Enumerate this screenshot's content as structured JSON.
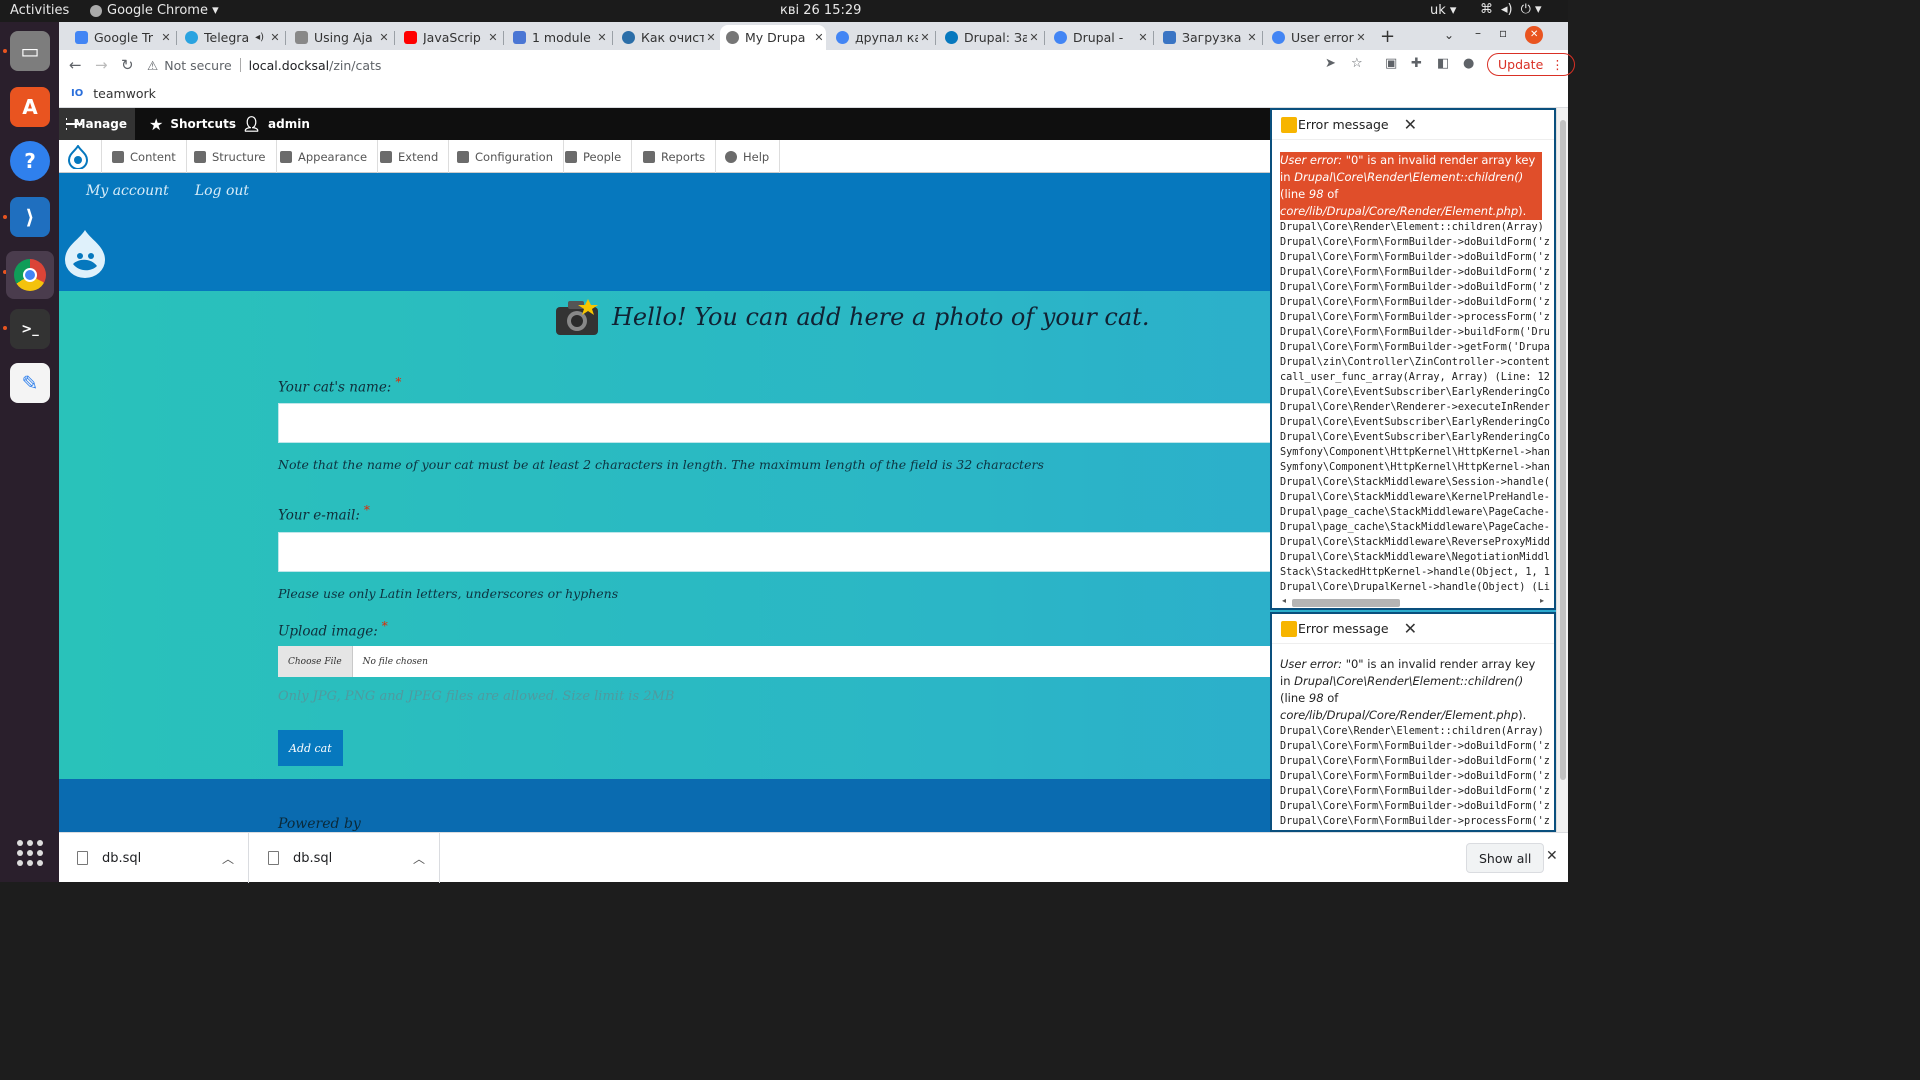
{
  "topbar": {
    "activities": "Activities",
    "app_name": "Google Chrome ▾",
    "clock": "кві 26  15:29",
    "lang": "uk ▾",
    "sys_icons": [
      "network-icon",
      "volume-icon",
      "power-icon"
    ]
  },
  "dock": {
    "items": [
      {
        "name": "files-icon",
        "color": "#7f7f7f",
        "glyph": "▭"
      },
      {
        "name": "software-center-icon",
        "color": "#e95420",
        "glyph": "A"
      },
      {
        "name": "help-icon",
        "color": "#2f80ed",
        "glyph": "?"
      },
      {
        "name": "vscode-icon",
        "color": "#1f6fbf",
        "glyph": "⟩"
      },
      {
        "name": "chrome-icon",
        "color": "#3a3a3a",
        "glyph": "◉"
      },
      {
        "name": "terminal-icon",
        "color": "#333",
        "glyph": ">_"
      },
      {
        "name": "text-editor-icon",
        "color": "#f4f4f4",
        "glyph": "✎"
      }
    ]
  },
  "tabs": [
    {
      "title": "Google Tr",
      "icon_color": "#4285f4"
    },
    {
      "title": "Telegra",
      "icon_color": "#2aa3e0"
    },
    {
      "title": "Using Aja",
      "icon_color": "#888"
    },
    {
      "title": "JavaScrip",
      "icon_color": "#ff0000"
    },
    {
      "title": "1 module",
      "icon_color": "#4a76d4"
    },
    {
      "title": "Как очист",
      "icon_color": "#2b6ea8"
    },
    {
      "title": "My Drupa",
      "icon_color": "#777",
      "active": true
    },
    {
      "title": "друпал ка",
      "icon_color": "#4285f4"
    },
    {
      "title": "Drupal: За",
      "icon_color": "#0678be"
    },
    {
      "title": "Drupal - ",
      "icon_color": "#4285f4"
    },
    {
      "title": "Загрузка",
      "icon_color": "#3a75c4"
    },
    {
      "title": "User error",
      "icon_color": "#4285f4"
    }
  ],
  "toolbar": {
    "not_secure": "Not secure",
    "url_host": "local.docksal",
    "url_path": "/zin/cats",
    "update_label": "Update"
  },
  "bookmarks": {
    "icon": "IO",
    "label": "teamwork"
  },
  "admin_toolbar": {
    "manage": "Manage",
    "shortcuts": "Shortcuts",
    "user": "admin",
    "menu": [
      "Content",
      "Structure",
      "Appearance",
      "Extend",
      "Configuration",
      "People",
      "Reports",
      "Help"
    ]
  },
  "site": {
    "my_account": "My account",
    "logout": "Log out",
    "heading": "Hello! You can add here a photo of your cat.",
    "name_label": "Your cat's name:",
    "name_hint": "Note that the name of your cat must be at least 2 characters in length. The maximum length of the field is 32 characters",
    "email_label": "Your e-mail:",
    "email_hint": "Please use only Latin letters, underscores or hyphens",
    "upload_label": "Upload image:",
    "choose_file": "Choose File",
    "no_file": "No file chosen",
    "upload_hint": "Only JPG, PNG and JPEG files are allowed. Size limit is 2MB",
    "submit": "Add cat",
    "powered": "Powered by"
  },
  "errors": [
    {
      "title": "Error message",
      "msg_prefix": "User error: ",
      "msg_main": "\"0\" is an invalid render array key in ",
      "msg_class": "Drupal\\Core\\Render\\Element::children()",
      "msg_line": " (line ",
      "msg_num": "98",
      "msg_of": " of ",
      "msg_file": "core/lib/Drupal/Core/Render/Element.php",
      "msg_end": ").",
      "trace": "Drupal\\Core\\Render\\Element::children(Array)\nDrupal\\Core\\Form\\FormBuilder->doBuildForm('z\nDrupal\\Core\\Form\\FormBuilder->doBuildForm('z\nDrupal\\Core\\Form\\FormBuilder->doBuildForm('z\nDrupal\\Core\\Form\\FormBuilder->doBuildForm('z\nDrupal\\Core\\Form\\FormBuilder->doBuildForm('z\nDrupal\\Core\\Form\\FormBuilder->processForm('z\nDrupal\\Core\\Form\\FormBuilder->buildForm('Dru\nDrupal\\Core\\Form\\FormBuilder->getForm('Drupa\nDrupal\\zin\\Controller\\ZinController->content\ncall_user_func_array(Array, Array) (Line: 12\nDrupal\\Core\\EventSubscriber\\EarlyRenderingCo\nDrupal\\Core\\Render\\Renderer->executeInRender\nDrupal\\Core\\EventSubscriber\\EarlyRenderingCo\nDrupal\\Core\\EventSubscriber\\EarlyRenderingCo\nSymfony\\Component\\HttpKernel\\HttpKernel->han\nSymfony\\Component\\HttpKernel\\HttpKernel->han\nDrupal\\Core\\StackMiddleware\\Session->handle(\nDrupal\\Core\\StackMiddleware\\KernelPreHandle-\nDrupal\\page_cache\\StackMiddleware\\PageCache-\nDrupal\\page_cache\\StackMiddleware\\PageCache-\nDrupal\\Core\\StackMiddleware\\ReverseProxyMidd\nDrupal\\Core\\StackMiddleware\\NegotiationMiddl\nStack\\StackedHttpKernel->handle(Object, 1, 1\nDrupal\\Core\\DrupalKernel->handle(Object) (Li",
      "highlighted": true
    },
    {
      "title": "Error message",
      "msg_prefix": "User error: ",
      "msg_main": "\"0\" is an invalid render array key in ",
      "msg_class": "Drupal\\Core\\Render\\Element::children()",
      "msg_line": " (line ",
      "msg_num": "98",
      "msg_of": " of ",
      "msg_file": "core/lib/Drupal/Core/Render/Element.php",
      "msg_end": ").",
      "trace": "Drupal\\Core\\Render\\Element::children(Array)\nDrupal\\Core\\Form\\FormBuilder->doBuildForm('z\nDrupal\\Core\\Form\\FormBuilder->doBuildForm('z\nDrupal\\Core\\Form\\FormBuilder->doBuildForm('z\nDrupal\\Core\\Form\\FormBuilder->doBuildForm('z\nDrupal\\Core\\Form\\FormBuilder->doBuildForm('z\nDrupal\\Core\\Form\\FormBuilder->processForm('z\nDrupal\\Core\\Form\\FormBuilder->buildForm('Dru\nDrupal\\Core\\Form\\FormBuilder->getForm('Drupa",
      "highlighted": false
    }
  ],
  "downloads": {
    "items": [
      "db.sql",
      "db.sql"
    ],
    "show_all": "Show all"
  }
}
